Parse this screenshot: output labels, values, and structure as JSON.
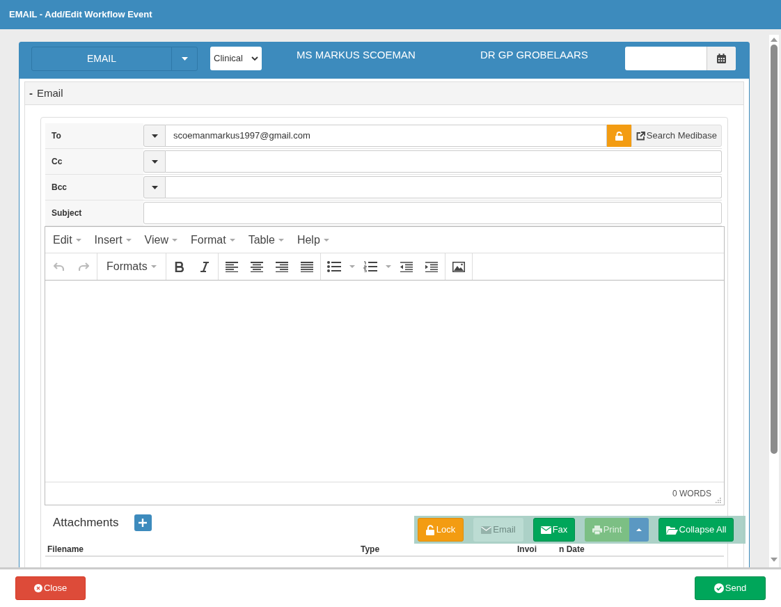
{
  "window": {
    "title": "EMAIL - Add/Edit Workflow Event"
  },
  "header": {
    "event_type": "EMAIL",
    "category": "Clinical",
    "patient": "MS MARKUS SCOEMAN",
    "doctor": "DR GP GROBELAARS"
  },
  "section": {
    "toggle": "-",
    "title": "Email",
    "expanded": true
  },
  "fields": [
    {
      "label": "To",
      "kind": "recipient",
      "value": "scoemanmarkus1997@gmail.com",
      "locked": false,
      "action": "Search Medibase"
    },
    {
      "label": "Cc",
      "kind": "recipient"
    },
    {
      "label": "Bcc",
      "kind": "recipient"
    },
    {
      "label": "Subject",
      "kind": "text"
    }
  ],
  "editor": {
    "menus": [
      "Edit",
      "Insert",
      "View",
      "Format",
      "Table",
      "Help"
    ],
    "undo_disabled": true,
    "redo_disabled": true,
    "formats": "Formats",
    "word_count": "0 WORDS"
  },
  "attachments": {
    "title": "Attachments",
    "columns": [
      "Filename",
      "Type",
      "Invoi",
      "n Date"
    ]
  },
  "actions": [
    {
      "label": "Lock",
      "kind": "lock",
      "disabled": false
    },
    {
      "label": "Email",
      "kind": "email",
      "disabled": true
    },
    {
      "label": "Fax",
      "kind": "fax",
      "disabled": false
    },
    {
      "label": "Print",
      "kind": "print",
      "disabled": true
    },
    {
      "label": "Collapse All",
      "kind": "collapse",
      "disabled": false
    }
  ],
  "footer": [
    {
      "label": "Close",
      "kind": "close"
    },
    {
      "label": "Send",
      "kind": "send"
    }
  ]
}
